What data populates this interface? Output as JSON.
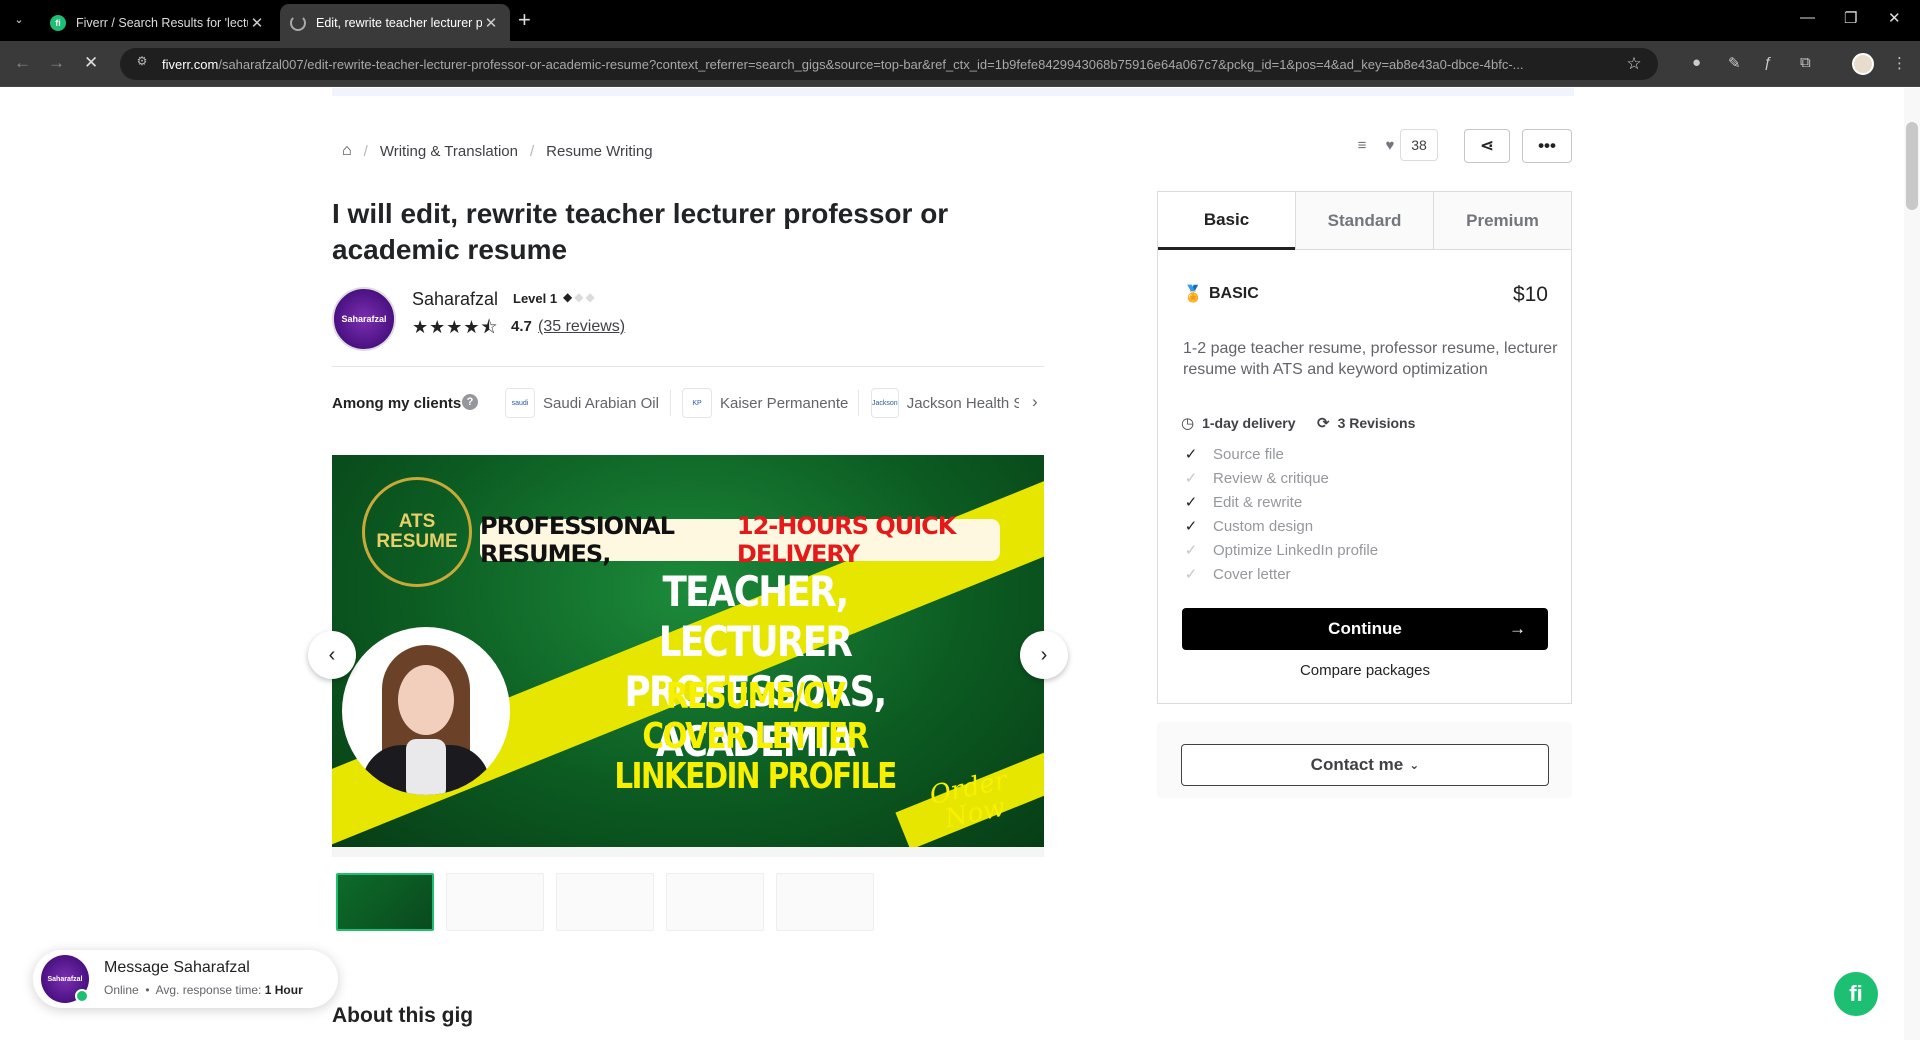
{
  "browser": {
    "tabs": [
      {
        "title": "Fiverr / Search Results for 'lectu",
        "favicon": "fiverr-icon"
      },
      {
        "title": "Edit, rewrite teacher lecturer pr",
        "favicon": "loading-icon"
      }
    ],
    "url_host": "fiverr.com",
    "url_path": "/saharafzal007/edit-rewrite-teacher-lecturer-professor-or-academic-resume?context_referrer=search_gigs&source=top-bar&ref_ctx_id=1b9fefe8429943068b75916e64a067c7&pckg_id=1&pos=4&ad_key=ab8e43a0-dbce-4bfc-..."
  },
  "breadcrumb": {
    "items": [
      "Writing & Translation",
      "Resume Writing"
    ]
  },
  "actions": {
    "save_count": "38"
  },
  "gig": {
    "title": "I will edit, rewrite teacher lecturer professor or academic resume"
  },
  "seller": {
    "name": "Saharafzal",
    "avatar_label": "Saharafzal",
    "level": "Level 1",
    "rating": "4.7",
    "reviews": "(35 reviews)",
    "stars": 4.7
  },
  "clients": {
    "label": "Among my clients",
    "items": [
      {
        "name": "Saudi Arabian Oil",
        "logo": "saudi"
      },
      {
        "name": "Kaiser Permanente",
        "logo": "KP"
      },
      {
        "name": "Jackson Health S",
        "logo": "Jackson"
      }
    ]
  },
  "hero": {
    "badge_line1": "ATS",
    "badge_line2": "RESUME",
    "pill_black": "PROFESSIONAL RESUMES,",
    "pill_red": "12-HOURS QUICK DELIVERY",
    "headline1": "TEACHER, LECTURER",
    "headline2": "PROFESSORS, ACADEMIA",
    "sub1": "RESUME/CV",
    "sub2": "COVER LETTER",
    "sub3": "LINKEDIN PROFILE",
    "order1": "Order",
    "order2": "Now"
  },
  "about": {
    "title": "About this gig"
  },
  "package": {
    "tabs": [
      "Basic",
      "Standard",
      "Premium"
    ],
    "name": "BASIC",
    "price": "$10",
    "description": "1-2 page teacher resume, professor resume, lecturer resume with ATS and keyword optimization",
    "delivery": "1-day delivery",
    "revisions": "3 Revisions",
    "features": [
      {
        "label": "Source file",
        "included": true
      },
      {
        "label": "Review & critique",
        "included": false
      },
      {
        "label": "Edit & rewrite",
        "included": true
      },
      {
        "label": "Custom design",
        "included": true
      },
      {
        "label": "Optimize LinkedIn profile",
        "included": false
      },
      {
        "label": "Cover letter",
        "included": false
      }
    ],
    "continue": "Continue",
    "compare": "Compare packages",
    "contact": "Contact me"
  },
  "message": {
    "title": "Message Saharafzal",
    "status": "Online",
    "avg_label": "Avg. response time:",
    "avg_value": "1 Hour"
  },
  "colors": {
    "accent": "#1dbf73",
    "brand_dark": "#222325"
  }
}
